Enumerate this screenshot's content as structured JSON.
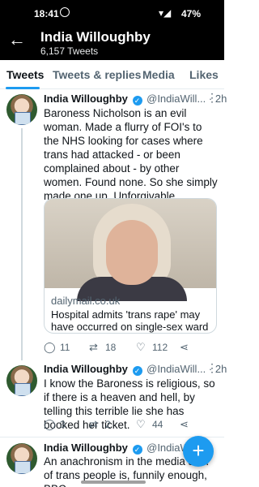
{
  "status_bar": {
    "time": "18:41",
    "battery": "47%"
  },
  "header": {
    "back": "←",
    "profile_name": "India Willoughby",
    "tweet_count": "6,157 Tweets"
  },
  "tabs": [
    "Tweets",
    "Tweets & replies",
    "Media",
    "Likes"
  ],
  "active_tab": "Tweets",
  "tweets": [
    {
      "author": "India Willoughby",
      "handle": "@IndiaWill...",
      "time": "· 2h",
      "text": "Baroness Nicholson is an evil woman. Made a flurry of FOI's to the NHS looking for cases where trans had attacked - or been complained about - by other women. Found none. So she simply made one up. Unforgivable. Reported by a blood-thirsty press,",
      "card": {
        "domain": "dailymail.co.uk",
        "title": "Hospital admits 'trans rape' may have occurred on single-sex ward"
      },
      "replies": "11",
      "retweets": "18",
      "likes": "112"
    },
    {
      "author": "India Willoughby",
      "handle": "@IndiaWill...",
      "time": "· 2h",
      "text": "I know the Baroness is religious, so if there is a heaven and hell, by telling this terrible lie she has booked her ticket.",
      "replies": "3",
      "retweets": "2",
      "likes": "44"
    },
    {
      "author": "India Willoughby",
      "handle": "@IndiaWill...",
      "text": "An anachronism in the media sh... of trans people is, funnily enough, BBC"
    }
  ],
  "icons": {
    "more": "more-icon",
    "reply": "reply-icon",
    "retweet": "retweet-icon",
    "like": "heart-icon",
    "share": "share-icon",
    "compose": "compose-icon"
  },
  "colors": {
    "accent": "#1d9bf0",
    "text": "#0f1419",
    "muted": "#536471"
  }
}
